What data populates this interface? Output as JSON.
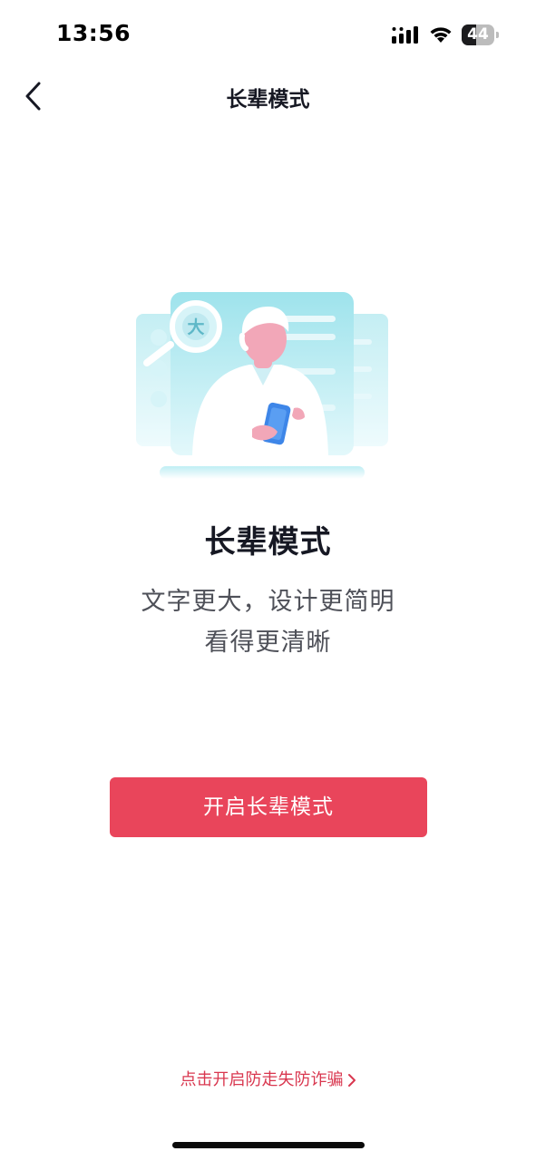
{
  "status_bar": {
    "time": "13:56",
    "battery_level": "44",
    "battery_fraction": 0.44
  },
  "nav": {
    "title": "长辈模式",
    "back_icon": "chevron-left-icon"
  },
  "illustration": {
    "badge_char": "大",
    "icon": "elder-with-phone-illustration"
  },
  "content": {
    "headline": "长辈模式",
    "subline_1": "文字更大，设计更简明",
    "subline_2": "看得更清晰"
  },
  "actions": {
    "enable_label": "开启长辈模式",
    "fraud_link_label": "点击开启防走失防诈骗"
  },
  "colors": {
    "accent": "#e9455b",
    "link": "#d9374f",
    "illustration_blue": "#8fd9e6",
    "illustration_pink": "#f2a7b8"
  }
}
